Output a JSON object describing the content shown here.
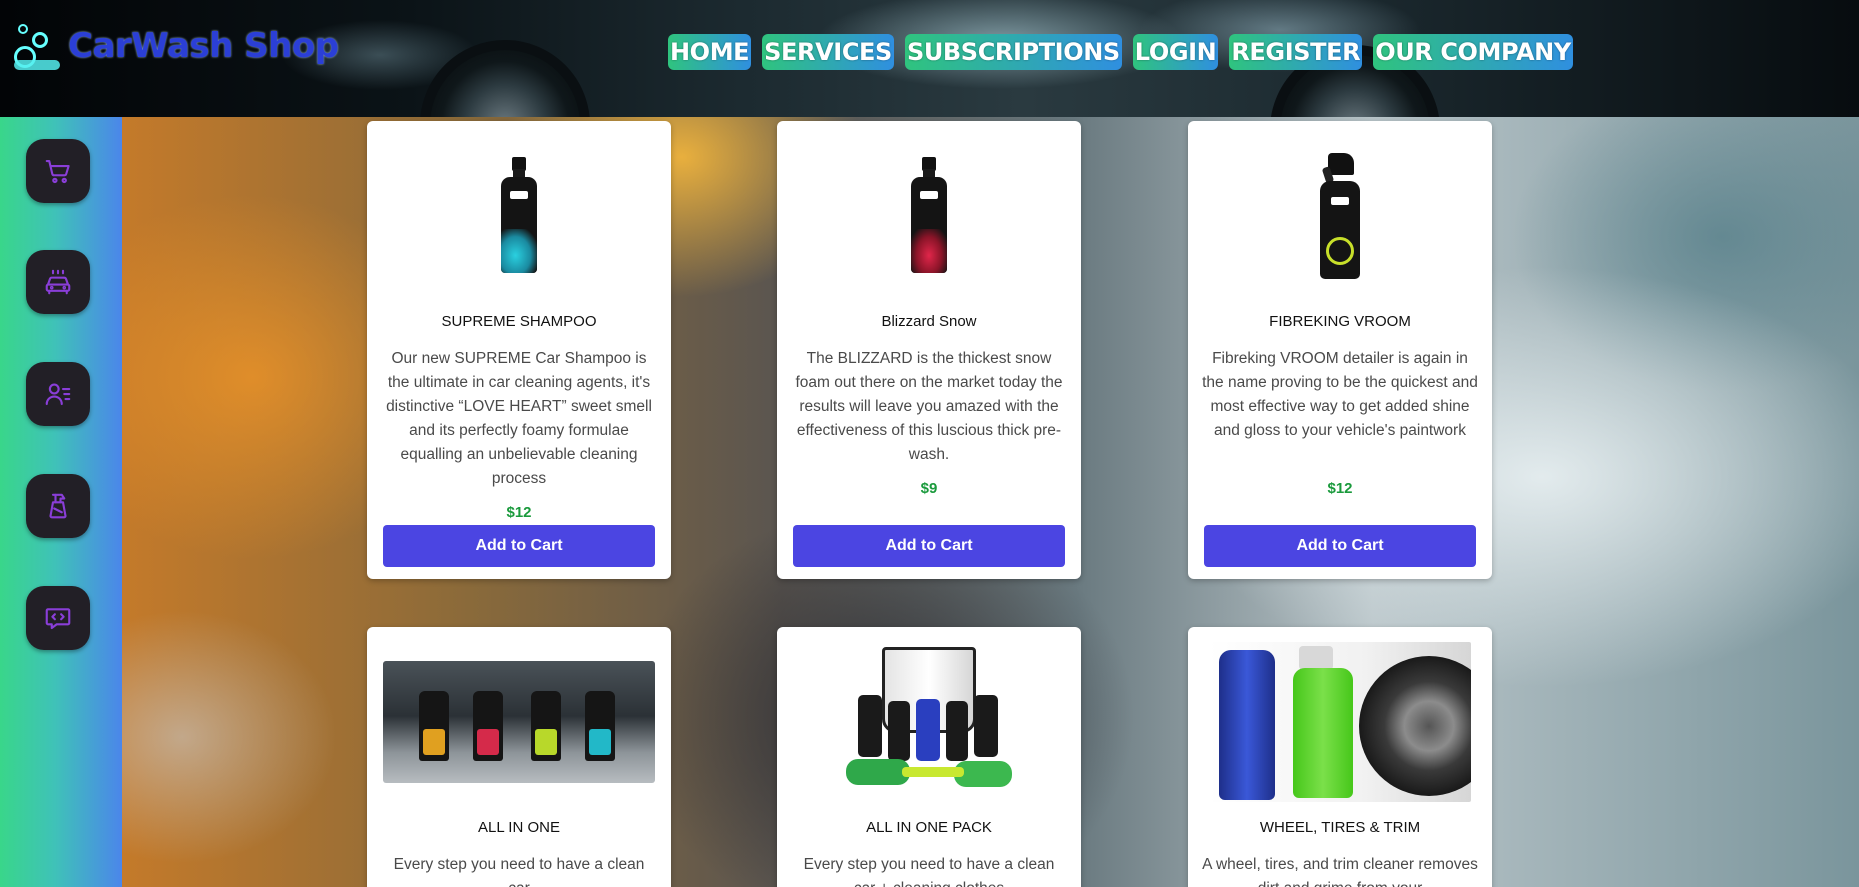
{
  "header": {
    "logo_text": "CarWash Shop",
    "nav": [
      "HOME",
      "SERVICES",
      "SUBSCRIPTIONS",
      "LOGIN",
      "REGISTER",
      "OUR COMPANY"
    ]
  },
  "sidebar": {
    "items": [
      {
        "icon": "cart-icon"
      },
      {
        "icon": "car-wash-icon"
      },
      {
        "icon": "user-list-icon"
      },
      {
        "icon": "spray-bottle-icon"
      },
      {
        "icon": "chat-code-icon"
      }
    ]
  },
  "products": [
    {
      "title": "SUPREME SHAMPOO",
      "desc": "Our new SUPREME Car Shampoo is the ultimate in car cleaning agents, it's distinctive “LOVE HEART” sweet smell and its perfectly foamy formulae equalling an unbelievable cleaning process",
      "price": "$12",
      "button": "Add to Cart"
    },
    {
      "title": "Blizzard Snow",
      "desc": "The BLIZZARD is the thickest snow foam out there on the market today the results will leave you amazed with the effectiveness of this luscious thick pre-wash.",
      "price": "$9",
      "button": "Add to Cart"
    },
    {
      "title": "FIBREKING VROOM",
      "desc": "Fibreking VROOM detailer is again in the name proving to be the quickest and most effective way to get added shine and gloss to your vehicle's paintwork",
      "price": "$12",
      "button": "Add to Cart"
    },
    {
      "title": "ALL IN ONE",
      "desc": "Every step you need to have a clean car"
    },
    {
      "title": "ALL IN ONE PACK",
      "desc": "Every step you need to have a clean car + cleaning clothes"
    },
    {
      "title": "WHEEL, TIRES & TRIM",
      "desc": "A wheel, tires, and trim cleaner removes dirt and grime from your"
    }
  ],
  "colors": {
    "nav_gradient_start": "#2fc47e",
    "nav_gradient_end": "#2f8fe0",
    "button": "#4b45e2",
    "price": "#1a9a3c",
    "logo": "#2b3fd6",
    "sidebar_icon": "#8a3ed8"
  }
}
